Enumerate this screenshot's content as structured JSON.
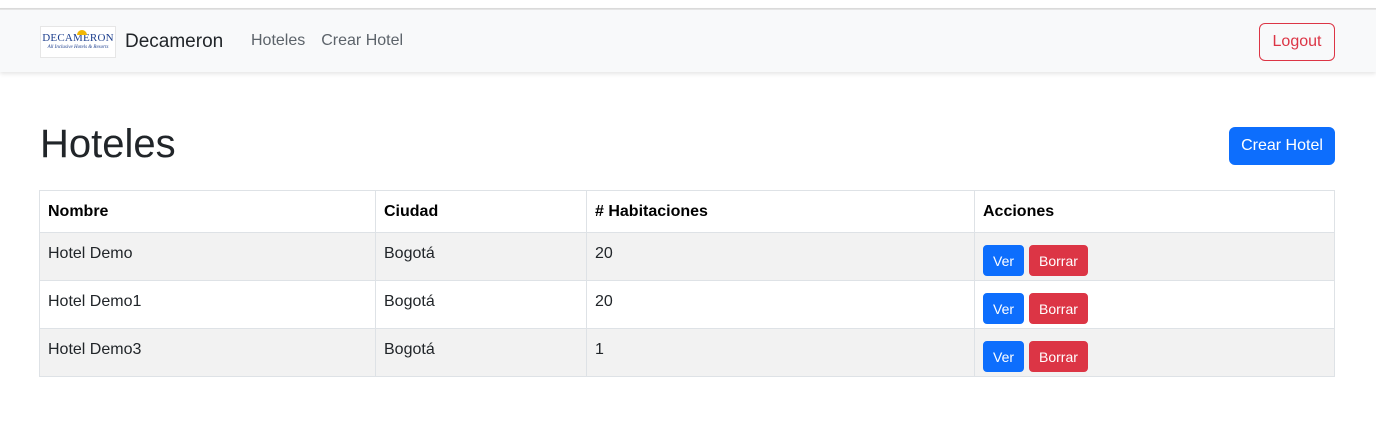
{
  "navbar": {
    "logo_text": "DECAMERON",
    "logo_tagline": "All Inclusive Hotels & Resorts",
    "brand": "Decameron",
    "links": [
      "Hoteles",
      "Crear Hotel"
    ],
    "logout_label": "Logout"
  },
  "page": {
    "title": "Hoteles",
    "create_label": "Crear Hotel"
  },
  "table": {
    "headers": [
      "Nombre",
      "Ciudad",
      "# Habitaciones",
      "Acciones"
    ],
    "rows": [
      {
        "nombre": "Hotel Demo",
        "ciudad": "Bogotá",
        "habitaciones": "20"
      },
      {
        "nombre": "Hotel Demo1",
        "ciudad": "Bogotá",
        "habitaciones": "20"
      },
      {
        "nombre": "Hotel Demo3",
        "ciudad": "Bogotá",
        "habitaciones": "1"
      }
    ],
    "view_label": "Ver",
    "delete_label": "Borrar"
  },
  "colors": {
    "primary": "#0d6efd",
    "danger": "#dc3545",
    "navbar_bg": "#f8f9fa",
    "stripe": "#f2f2f2"
  }
}
